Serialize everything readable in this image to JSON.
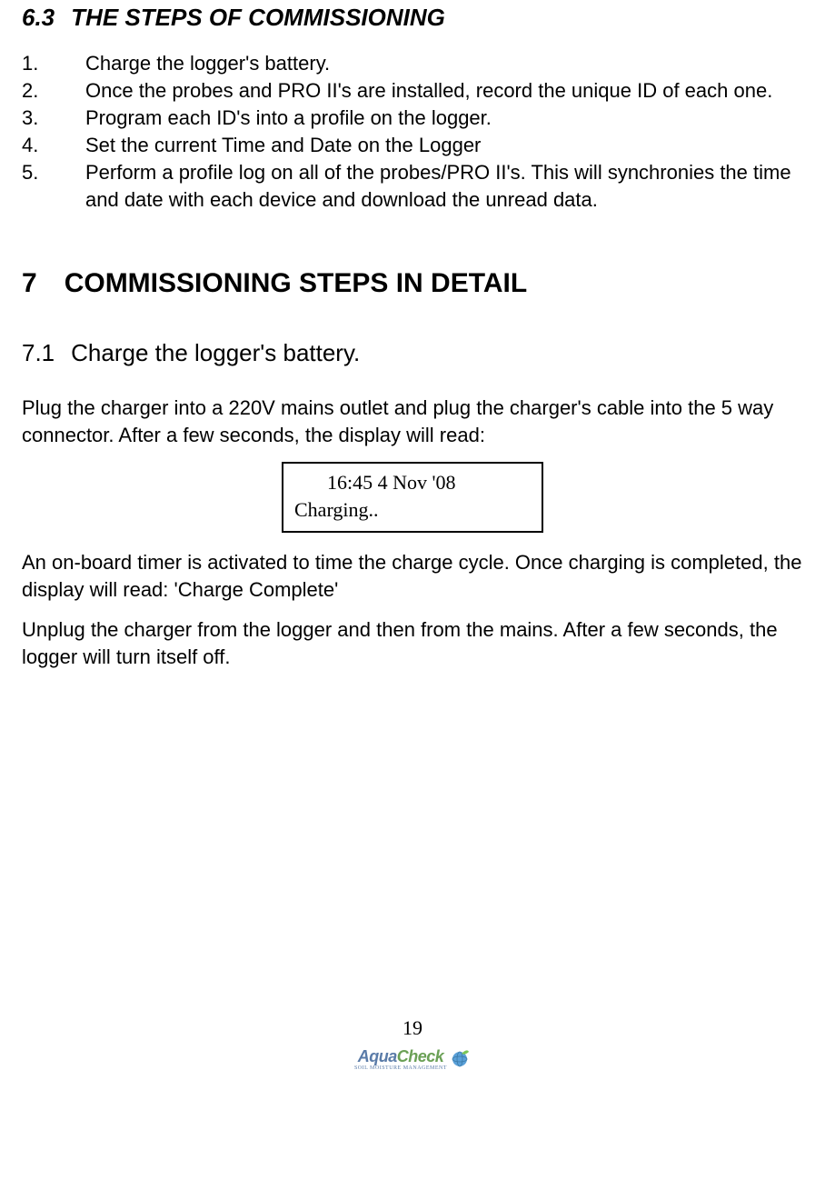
{
  "section63": {
    "number": "6.3",
    "title": "THE STEPS OF COMMISSIONING"
  },
  "steps": [
    {
      "num": "1.",
      "text": "Charge the logger's battery."
    },
    {
      "num": "2.",
      "text": "Once the probes and PRO II's are installed, record the unique ID of each one."
    },
    {
      "num": "3.",
      "text": "Program each ID's into a profile on the logger."
    },
    {
      "num": "4.",
      "text": "Set the current Time and Date on the Logger"
    },
    {
      "num": "5.",
      "text": "Perform a profile log on all of the probes/PRO II's. This will synchronies the time and date with each device and download the unread data."
    }
  ],
  "section7": {
    "number": "7",
    "title": "COMMISSIONING STEPS IN DETAIL"
  },
  "section71": {
    "number": "7.1",
    "title": "Charge the logger's battery."
  },
  "para71_a": "Plug the charger into a 220V mains outlet and plug the charger's cable into the 5 way connector.  After a few seconds, the display will read:",
  "display": {
    "line1": "16:45  4 Nov '08",
    "line2": "Charging.."
  },
  "para71_b": "An on-board timer is activated to time the charge cycle.  Once charging is completed, the display will read: 'Charge Complete'",
  "para71_c": "Unplug the charger from the logger and then from the mains.  After a few seconds, the logger will turn itself off.",
  "footer": {
    "page_number": "19",
    "logo_aqua": "Aqua",
    "logo_check": "Check",
    "logo_sub": "SOIL MOISTURE MANAGEMENT"
  }
}
